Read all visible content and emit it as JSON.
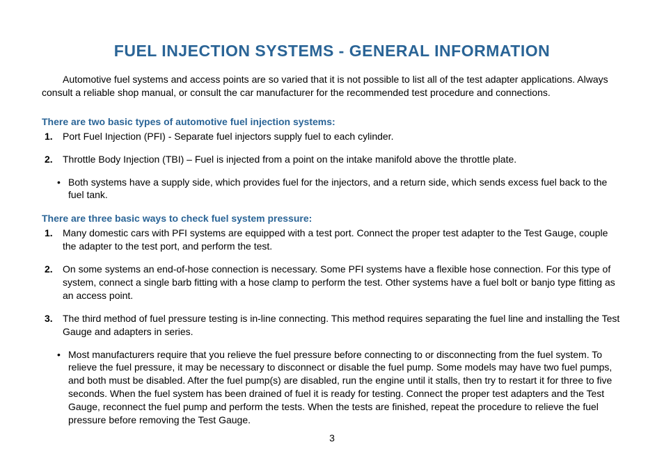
{
  "title": "FUEL INJECTION SYSTEMS - GENERAL INFORMATION",
  "intro": "Automotive fuel systems and access points are so varied that it is not possible to list all of the test adapter applications. Always consult a reliable shop manual, or consult the car manufacturer for the recommended test procedure and connections.",
  "section1": {
    "heading": "There are two basic types of automotive fuel injection systems:",
    "items": [
      "Port Fuel Injection  (PFI) - Separate fuel injectors supply fuel to each cylinder.",
      "Throttle Body Injection (TBI) – Fuel is injected from a point on the intake manifold above the throttle plate."
    ],
    "bullets": [
      "Both systems have a supply side, which provides fuel for the injectors, and a return side, which sends excess fuel back to the fuel tank."
    ]
  },
  "section2": {
    "heading": "There are three basic ways to check fuel system pressure:",
    "items": [
      "Many domestic cars with PFI systems are equipped with a test port.  Connect the proper test adapter to the Test Gauge, couple the adapter to the test port, and perform the test.",
      "On some systems an end-of-hose connection is necessary.  Some PFI systems have a flexible hose connection.  For this type of system, connect a single barb fitting with a hose clamp to perform the test.  Other systems have a fuel bolt or banjo type fitting as an access point.",
      "The third method of fuel pressure testing is in-line connecting.  This method requires separating the fuel line and installing the Test Gauge and adapters in series."
    ],
    "bullets": [
      "Most manufacturers require that you relieve the fuel pressure before connecting to or disconnecting from the fuel system.  To relieve the fuel pressure, it may be necessary to disconnect or disable the fuel pump.  Some models may have two fuel pumps, and both must be disabled.  After the fuel pump(s) are disabled, run the engine until it stalls, then try to restart it for three to five seconds.  When the fuel system has been drained of fuel it is ready for testing. Connect the proper test adapters and the Test Gauge, reconnect the fuel pump and perform the tests.  When the tests are finished, repeat the procedure to relieve the fuel pressure before removing the Test Gauge."
    ]
  },
  "pageNumber": "3"
}
